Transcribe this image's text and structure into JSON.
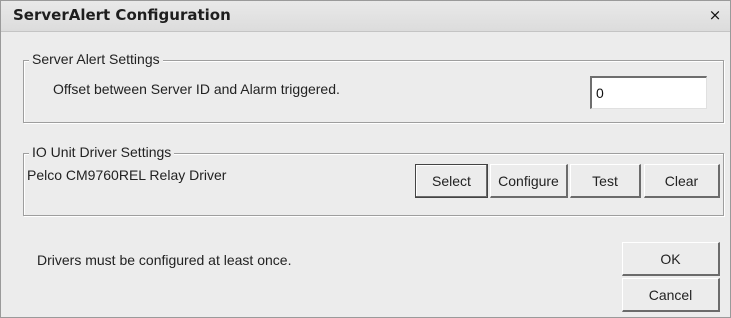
{
  "window": {
    "title": "ServerAlert Configuration",
    "close_label": "×"
  },
  "server_alert": {
    "group_label": "Server Alert Settings",
    "offset_label": "Offset between Server ID and Alarm triggered.",
    "offset_value": "0"
  },
  "io_unit": {
    "group_label": "IO Unit Driver Settings",
    "driver_name": "Pelco CM9760REL Relay Driver",
    "buttons": {
      "select": "Select",
      "configure": "Configure",
      "test": "Test",
      "clear": "Clear"
    }
  },
  "footer": {
    "note": "Drivers must be configured at least once.",
    "ok": "OK",
    "cancel": "Cancel"
  }
}
